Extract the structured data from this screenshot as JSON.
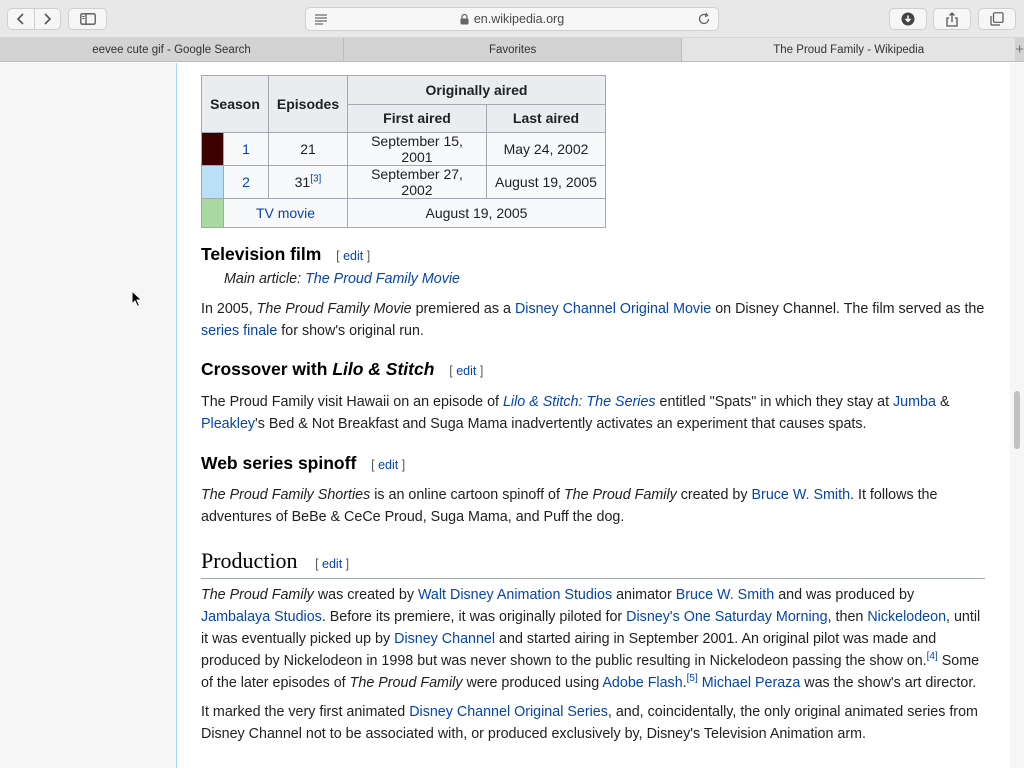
{
  "browser": {
    "url": "en.wikipedia.org",
    "tabs": [
      {
        "label": "eevee cute gif - Google Search",
        "active": false
      },
      {
        "label": "Favorites",
        "active": false
      },
      {
        "label": "The Proud Family - Wikipedia",
        "active": true
      }
    ],
    "new_tab": "+"
  },
  "episodes_table": {
    "headers": {
      "season": "Season",
      "episodes": "Episodes",
      "aired": "Originally aired",
      "first": "First aired",
      "last": "Last aired"
    },
    "rows": [
      {
        "season": "1",
        "episodes": "21",
        "ref": "",
        "first": "September 15, 2001",
        "last": "May 24, 2002",
        "color": "#3b0200"
      },
      {
        "season": "2",
        "episodes": "31",
        "ref": "[3]",
        "first": "September 27, 2002",
        "last": "August 19, 2005",
        "color": "#b9e0f4"
      },
      {
        "movie_label": "TV movie",
        "date": "August 19, 2005",
        "color": "#a8d9a0"
      }
    ]
  },
  "sections": {
    "tv_film": {
      "heading": "Television film",
      "edit": "edit",
      "hatnote_prefix": "Main article:",
      "hatnote_link": "The Proud Family Movie",
      "p1": "In 2005,",
      "p2": "The Proud Family Movie",
      "p3": "premiered as a",
      "p4": "Disney Channel Original Movie",
      "p5": "on Disney Channel. The film served as the",
      "p6": "series finale",
      "p7": "for show's original run."
    },
    "crossover": {
      "heading_a": "Crossover with",
      "heading_b": "Lilo & Stitch",
      "edit": "edit",
      "p1": "The Proud Family visit Hawaii on an episode of",
      "p2": "Lilo & Stitch: The Series",
      "p3": "entitled \"Spats\" in which they stay at",
      "p4": "Jumba",
      "p5": "&",
      "p6": "Pleakley",
      "p7": "'s Bed & Not Breakfast and Suga Mama inadvertently activates an experiment that causes spats."
    },
    "web_series": {
      "heading": "Web series spinoff",
      "edit": "edit",
      "p1": "The Proud Family Shorties",
      "p2": "is an online cartoon spinoff of",
      "p3": "The Proud Family",
      "p4": "created by",
      "p5": "Bruce W. Smith",
      "p6": ". It follows the adventures of BeBe & CeCe Proud, Suga Mama, and Puff the dog."
    },
    "production": {
      "heading": "Production",
      "edit": "edit",
      "a1": "The Proud Family",
      "a2": "was created by",
      "a3": "Walt Disney Animation Studios",
      "a4": "animator",
      "a5": "Bruce W. Smith",
      "a6": "and was produced by",
      "a7": "Jambalaya Studios",
      "a8": ". Before its premiere, it was originally piloted for",
      "a9": "Disney's One Saturday Morning",
      "a10": ", then",
      "a11": "Nickelodeon",
      "a12": ", until it was eventually picked up by",
      "a13": "Disney Channel",
      "a14": "and started airing in September 2001. An original pilot was made and produced by Nickelodeon in 1998 but was never shown to the public resulting in Nickelodeon passing the show on.",
      "ref4": "[4]",
      "a15": "Some of the later episodes of",
      "a16": "The Proud Family",
      "a17": "were produced using",
      "a18": "Adobe Flash",
      "a19": ".",
      "ref5": "[5]",
      "a20": "Michael Peraza",
      "a21": "was the show's art director.",
      "b1": "It marked the very first animated",
      "b2": "Disney Channel Original Series",
      "b3": ", and, coincidentally, the only original animated series from Disney Channel not to be associated with, or produced exclusively by, Disney's Television Animation arm."
    }
  }
}
